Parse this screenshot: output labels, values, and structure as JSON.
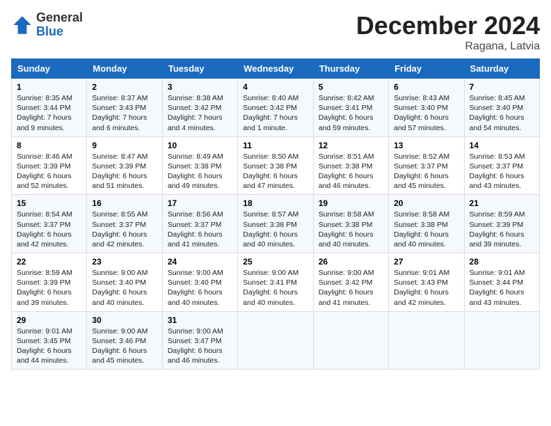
{
  "header": {
    "logo_general": "General",
    "logo_blue": "Blue",
    "month_title": "December 2024",
    "location": "Ragana, Latvia"
  },
  "days_of_week": [
    "Sunday",
    "Monday",
    "Tuesday",
    "Wednesday",
    "Thursday",
    "Friday",
    "Saturday"
  ],
  "weeks": [
    [
      {
        "day": "1",
        "sunrise": "8:35 AM",
        "sunset": "3:44 PM",
        "daylight": "7 hours and 9 minutes."
      },
      {
        "day": "2",
        "sunrise": "8:37 AM",
        "sunset": "3:43 PM",
        "daylight": "7 hours and 6 minutes."
      },
      {
        "day": "3",
        "sunrise": "8:38 AM",
        "sunset": "3:42 PM",
        "daylight": "7 hours and 4 minutes."
      },
      {
        "day": "4",
        "sunrise": "8:40 AM",
        "sunset": "3:42 PM",
        "daylight": "7 hours and 1 minute."
      },
      {
        "day": "5",
        "sunrise": "8:42 AM",
        "sunset": "3:41 PM",
        "daylight": "6 hours and 59 minutes."
      },
      {
        "day": "6",
        "sunrise": "8:43 AM",
        "sunset": "3:40 PM",
        "daylight": "6 hours and 57 minutes."
      },
      {
        "day": "7",
        "sunrise": "8:45 AM",
        "sunset": "3:40 PM",
        "daylight": "6 hours and 54 minutes."
      }
    ],
    [
      {
        "day": "8",
        "sunrise": "8:46 AM",
        "sunset": "3:39 PM",
        "daylight": "6 hours and 52 minutes."
      },
      {
        "day": "9",
        "sunrise": "8:47 AM",
        "sunset": "3:39 PM",
        "daylight": "6 hours and 51 minutes."
      },
      {
        "day": "10",
        "sunrise": "8:49 AM",
        "sunset": "3:38 PM",
        "daylight": "6 hours and 49 minutes."
      },
      {
        "day": "11",
        "sunrise": "8:50 AM",
        "sunset": "3:38 PM",
        "daylight": "6 hours and 47 minutes."
      },
      {
        "day": "12",
        "sunrise": "8:51 AM",
        "sunset": "3:38 PM",
        "daylight": "6 hours and 46 minutes."
      },
      {
        "day": "13",
        "sunrise": "8:52 AM",
        "sunset": "3:37 PM",
        "daylight": "6 hours and 45 minutes."
      },
      {
        "day": "14",
        "sunrise": "8:53 AM",
        "sunset": "3:37 PM",
        "daylight": "6 hours and 43 minutes."
      }
    ],
    [
      {
        "day": "15",
        "sunrise": "8:54 AM",
        "sunset": "3:37 PM",
        "daylight": "6 hours and 42 minutes."
      },
      {
        "day": "16",
        "sunrise": "8:55 AM",
        "sunset": "3:37 PM",
        "daylight": "6 hours and 42 minutes."
      },
      {
        "day": "17",
        "sunrise": "8:56 AM",
        "sunset": "3:37 PM",
        "daylight": "6 hours and 41 minutes."
      },
      {
        "day": "18",
        "sunrise": "8:57 AM",
        "sunset": "3:38 PM",
        "daylight": "6 hours and 40 minutes."
      },
      {
        "day": "19",
        "sunrise": "8:58 AM",
        "sunset": "3:38 PM",
        "daylight": "6 hours and 40 minutes."
      },
      {
        "day": "20",
        "sunrise": "8:58 AM",
        "sunset": "3:38 PM",
        "daylight": "6 hours and 40 minutes."
      },
      {
        "day": "21",
        "sunrise": "8:59 AM",
        "sunset": "3:39 PM",
        "daylight": "6 hours and 39 minutes."
      }
    ],
    [
      {
        "day": "22",
        "sunrise": "8:59 AM",
        "sunset": "3:39 PM",
        "daylight": "6 hours and 39 minutes."
      },
      {
        "day": "23",
        "sunrise": "9:00 AM",
        "sunset": "3:40 PM",
        "daylight": "6 hours and 40 minutes."
      },
      {
        "day": "24",
        "sunrise": "9:00 AM",
        "sunset": "3:40 PM",
        "daylight": "6 hours and 40 minutes."
      },
      {
        "day": "25",
        "sunrise": "9:00 AM",
        "sunset": "3:41 PM",
        "daylight": "6 hours and 40 minutes."
      },
      {
        "day": "26",
        "sunrise": "9:00 AM",
        "sunset": "3:42 PM",
        "daylight": "6 hours and 41 minutes."
      },
      {
        "day": "27",
        "sunrise": "9:01 AM",
        "sunset": "3:43 PM",
        "daylight": "6 hours and 42 minutes."
      },
      {
        "day": "28",
        "sunrise": "9:01 AM",
        "sunset": "3:44 PM",
        "daylight": "6 hours and 43 minutes."
      }
    ],
    [
      {
        "day": "29",
        "sunrise": "9:01 AM",
        "sunset": "3:45 PM",
        "daylight": "6 hours and 44 minutes."
      },
      {
        "day": "30",
        "sunrise": "9:00 AM",
        "sunset": "3:46 PM",
        "daylight": "6 hours and 45 minutes."
      },
      {
        "day": "31",
        "sunrise": "9:00 AM",
        "sunset": "3:47 PM",
        "daylight": "6 hours and 46 minutes."
      },
      null,
      null,
      null,
      null
    ]
  ]
}
